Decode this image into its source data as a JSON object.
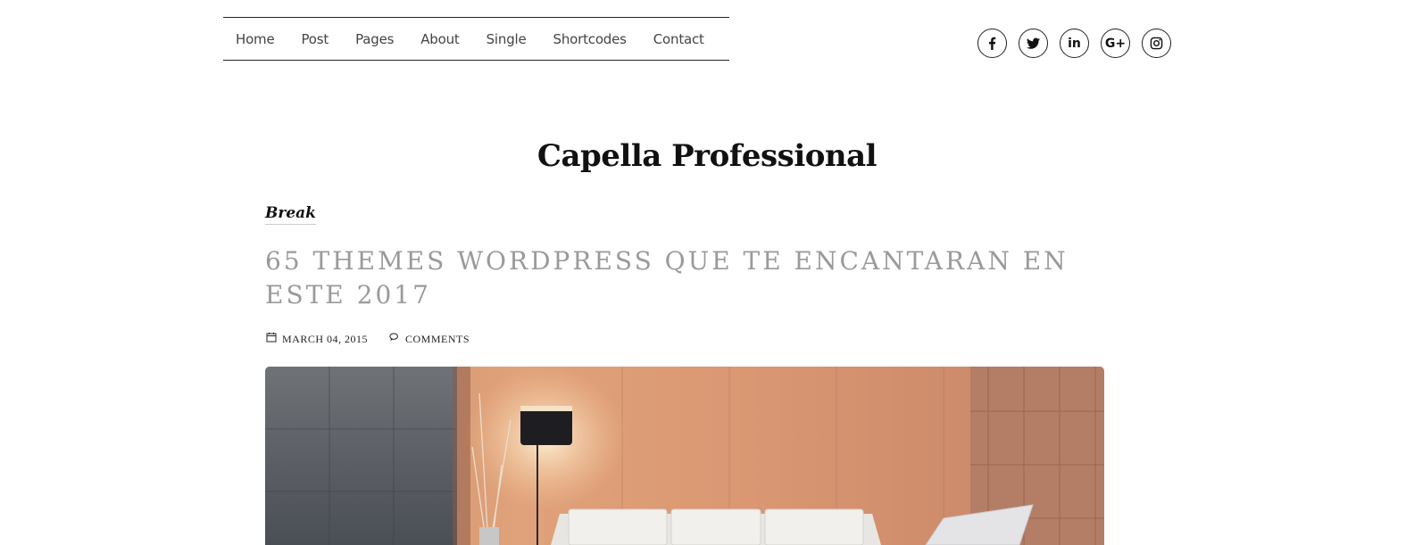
{
  "nav": {
    "items": [
      "Home",
      "Post",
      "Pages",
      "About",
      "Single",
      "Shortcodes",
      "Contact"
    ]
  },
  "social": {
    "icons": [
      "facebook-icon",
      "twitter-icon",
      "linkedin-icon",
      "google-plus-icon",
      "instagram-icon"
    ],
    "linkedin_text": "in",
    "gplus_text": "G+"
  },
  "site_title": "Capella Professional",
  "post": {
    "category": "Break",
    "title": "65 THEMES WORDPRESS QUE TE ENCANTARAN EN ESTE 2017",
    "date": "MARCH 04, 2015",
    "comments_label": "COMMENTS"
  }
}
